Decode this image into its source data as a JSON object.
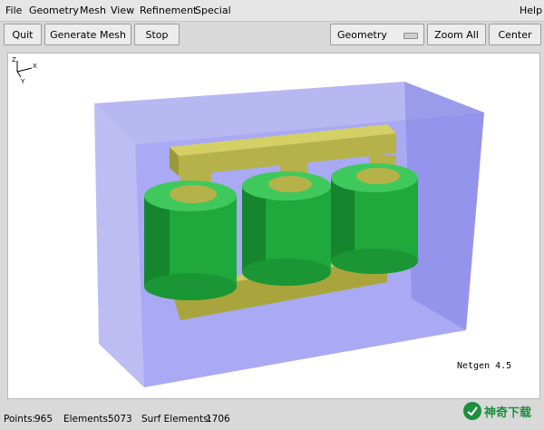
{
  "menu": {
    "left": [
      "File",
      "Geometry",
      "Mesh",
      "View",
      "Refinement",
      "Special"
    ],
    "right": "Help"
  },
  "toolbar": {
    "quit": "Quit",
    "generate_mesh": "Generate Mesh",
    "stop": "Stop",
    "view_select": "Geometry",
    "zoom_all": "Zoom All",
    "center": "Center"
  },
  "viewport": {
    "version": "Netgen 4.5",
    "axis_labels": {
      "z": "Z",
      "x": "X",
      "y": "Y"
    },
    "colors": {
      "box": "#8c8cf0",
      "core": "#b8b548",
      "coil": "#1fa83c"
    }
  },
  "status": {
    "points_label": "Points:",
    "points": "965",
    "elements_label": "Elements:",
    "elements": "5073",
    "surf_label": "Surf Elements:",
    "surf": "1706"
  },
  "watermark": {
    "text": "神奇下载"
  }
}
